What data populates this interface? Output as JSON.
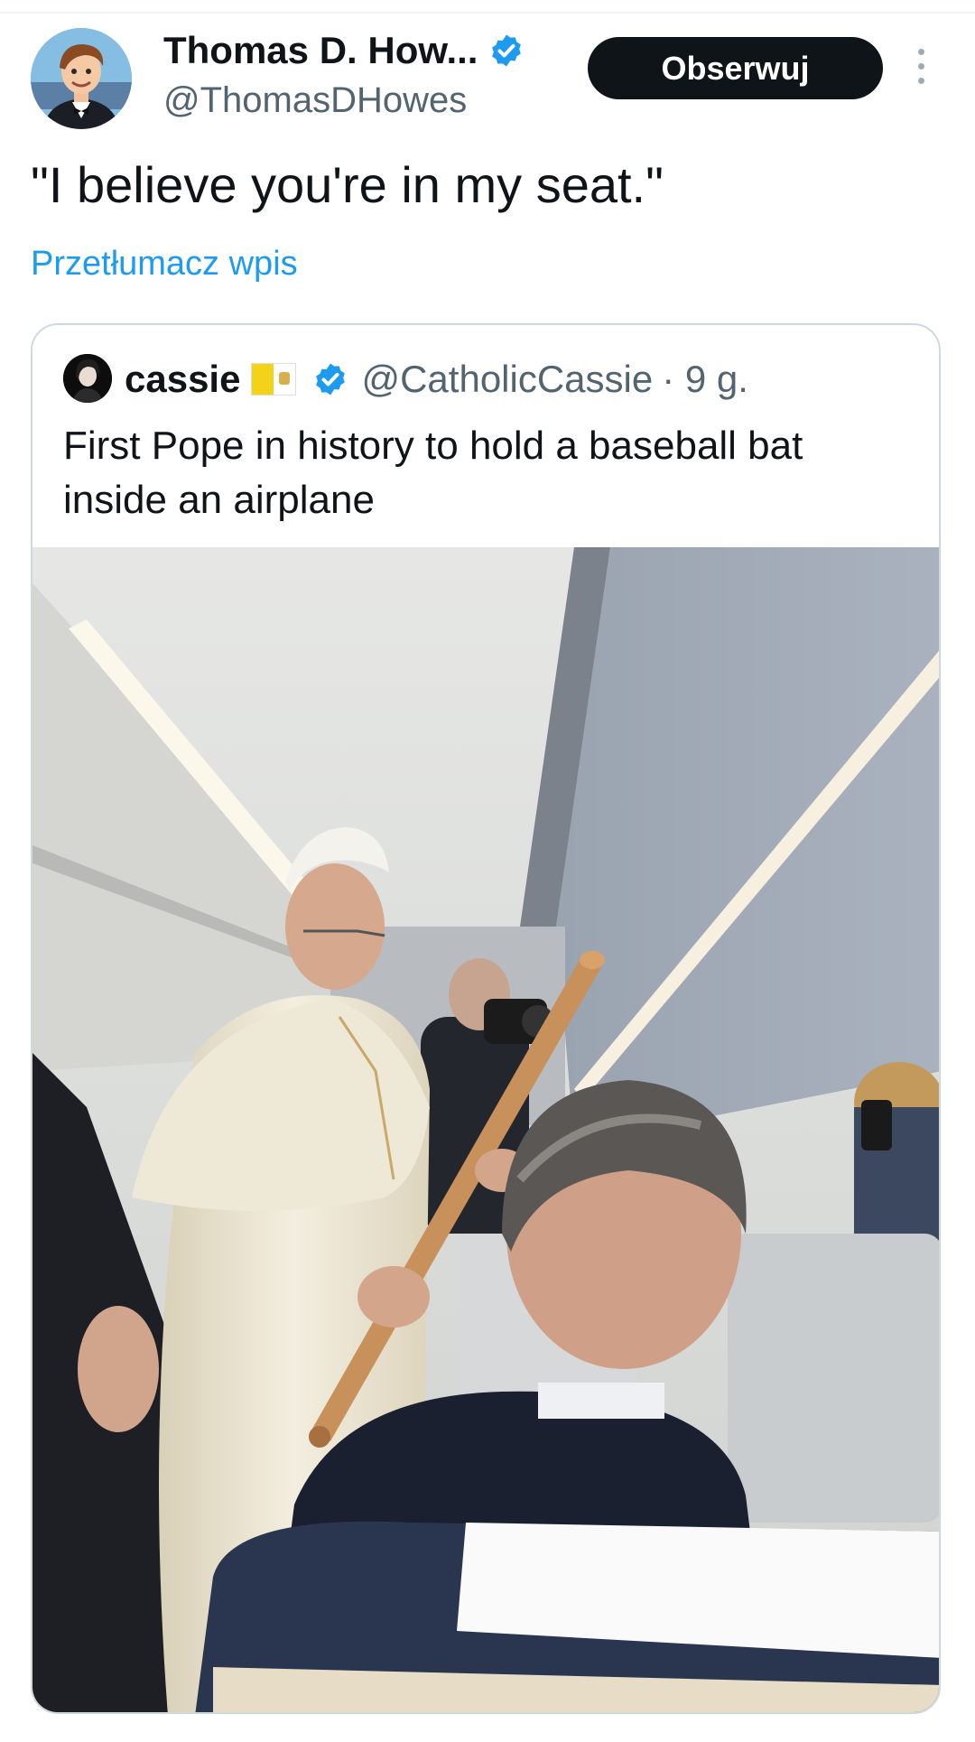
{
  "tweet": {
    "author_name": "Thomas D. How...",
    "author_handle": "@ThomasDHowes",
    "follow_label": "Obserwuj",
    "text": "\"I believe you're in my seat.\"",
    "translate_label": "Przetłumacz wpis"
  },
  "quoted": {
    "author_name": "cassie",
    "author_handle": "@CatholicCassie",
    "time": "· 9 g.",
    "text": "First Pope in history to hold a baseball bat inside an airplane"
  },
  "icons": {
    "verified": "verified-badge-icon",
    "more": "more-vertical-icon",
    "flag": "vatican-flag-icon"
  },
  "colors": {
    "accent": "#1d9bf0",
    "text": "#0f1419",
    "secondary": "#536471",
    "button_bg": "#0f1419"
  }
}
